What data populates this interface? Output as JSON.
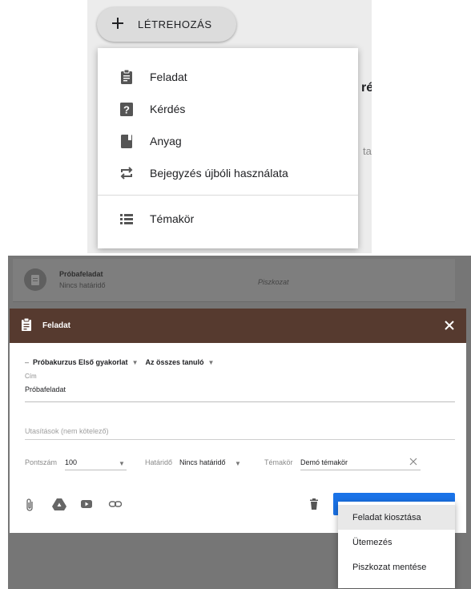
{
  "create_panel": {
    "create_button_label": "LÉTREHOZÁS",
    "background_fragment_1": "ré",
    "background_fragment_2": "ta",
    "menu_items": [
      {
        "label": "Feladat",
        "icon": "assignment-icon"
      },
      {
        "label": "Kérdés",
        "icon": "question-icon"
      },
      {
        "label": "Anyag",
        "icon": "material-icon"
      },
      {
        "label": "Bejegyzés újbóli használata",
        "icon": "reuse-post-icon"
      },
      {
        "label": "Témakör",
        "icon": "topic-list-icon"
      }
    ]
  },
  "draft_row": {
    "title": "Próbafeladat",
    "due": "Nincs határidő",
    "status": "Piszkozat"
  },
  "dialog": {
    "header_title": "Feladat",
    "course": "Próbakurzus Első gyakorlat",
    "students": "Az összes tanuló",
    "title_label": "Cím",
    "title_value": "Próbafeladat",
    "instructions_placeholder": "Utasítások (nem kötelező)",
    "points_label": "Pontszám",
    "points_value": "100",
    "due_label": "Határidő",
    "due_value": "Nincs határidő",
    "topic_label": "Témakör",
    "topic_value": "Demó témakör"
  },
  "assign_menu": {
    "items": [
      "Feladat kiosztása",
      "Ütemezés",
      "Piszkozat mentése"
    ]
  },
  "colors": {
    "header_brown": "#563a2f",
    "assign_blue": "#1a73e8",
    "overlay_gray": "#767676"
  }
}
